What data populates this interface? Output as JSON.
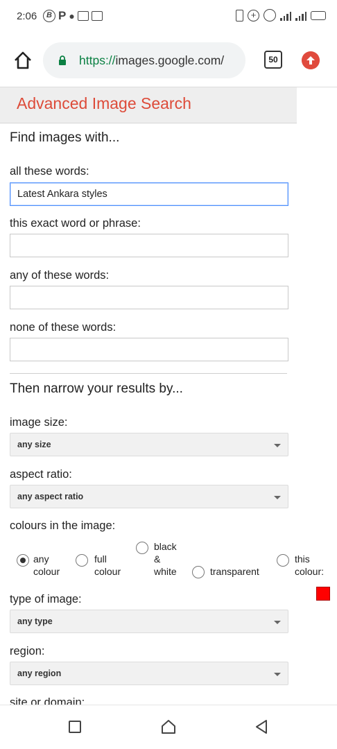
{
  "status_bar": {
    "time": "2:06",
    "left_icons": [
      "b-circle-icon",
      "p-icon",
      "chat-icon",
      "image-icon",
      "chart-icon"
    ],
    "right_icons": [
      "phone-icon",
      "plus-circle-icon",
      "alarm-icon",
      "signal-icon",
      "battery-icon"
    ],
    "battery_color": "#21a33a"
  },
  "browser": {
    "url_scheme": "https://",
    "url_host": "images.google.com/",
    "tab_count": "50",
    "accent": "#e04a3d"
  },
  "page": {
    "title": "Advanced Image Search",
    "title_color": "#dd4b39",
    "find_heading": "Find images with...",
    "all_words_label": "all these words:",
    "all_words_value": "Latest Ankara styles",
    "exact_phrase_label": "this exact word or phrase:",
    "exact_phrase_value": "",
    "any_words_label": "any of these words:",
    "any_words_value": "",
    "none_words_label": "none of these words:",
    "none_words_value": "",
    "narrow_heading": "Then narrow your results by...",
    "image_size_label": "image size:",
    "image_size_value": "any size",
    "aspect_ratio_label": "aspect ratio:",
    "aspect_ratio_value": "any aspect ratio",
    "colours_label": "colours in the image:",
    "colour_options": [
      {
        "line1": "any",
        "line2": "colour",
        "checked": true
      },
      {
        "line1": "full",
        "line2": "colour",
        "checked": false
      },
      {
        "line1": "black",
        "line2": "&",
        "line3": "white",
        "checked": false
      },
      {
        "line1": "transparent",
        "checked": false
      },
      {
        "line1": "this",
        "line2": "colour:",
        "checked": false
      }
    ],
    "swatch_color": "#ff0000",
    "type_label": "type of image:",
    "type_value": "any type",
    "region_label": "region:",
    "region_value": "any region",
    "site_label": "site or domain:"
  }
}
